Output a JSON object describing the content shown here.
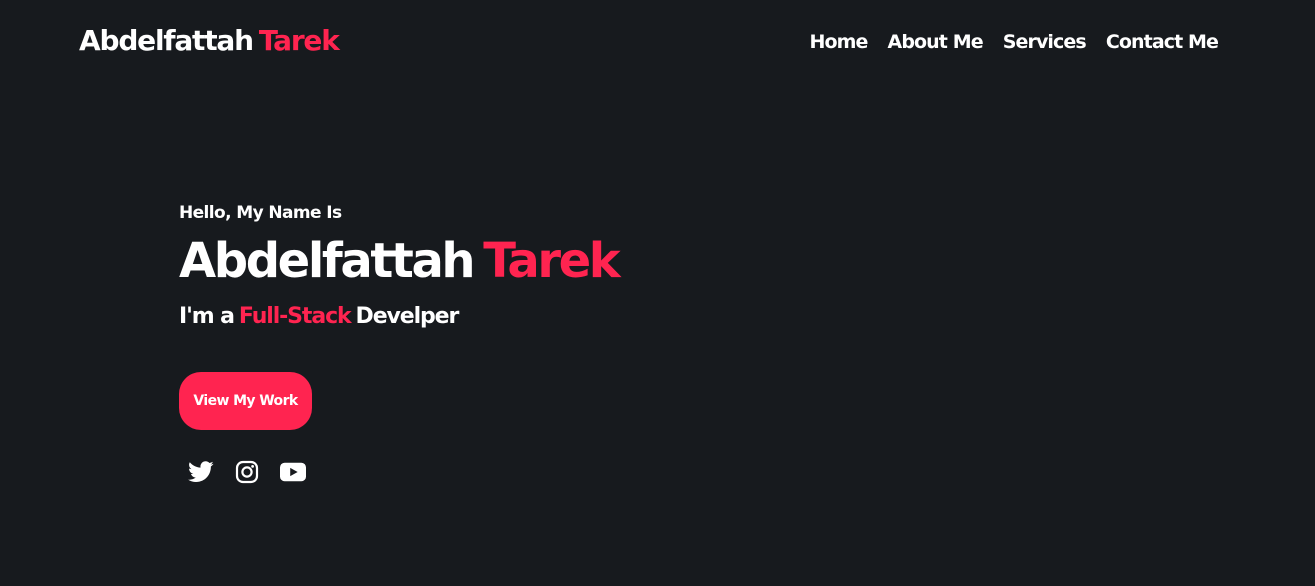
{
  "header": {
    "brand_first": "Abdelfattah",
    "brand_last": "Tarek"
  },
  "nav": {
    "items": [
      {
        "label": "Home"
      },
      {
        "label": "About Me"
      },
      {
        "label": "Services"
      },
      {
        "label": "Contact Me"
      }
    ]
  },
  "hero": {
    "greeting": "Hello, My Name Is",
    "name_first": "Abdelfattah",
    "name_last": "Tarek",
    "role_prefix": "I'm a",
    "role_highlight": "Full-Stack",
    "role_suffix": "Develper",
    "cta_label": "View My Work"
  },
  "socials": [
    {
      "icon": "twitter-icon"
    },
    {
      "icon": "instagram-icon"
    },
    {
      "icon": "youtube-icon"
    }
  ],
  "colors": {
    "background": "#171a1e",
    "accent": "#ff2450",
    "text": "#ffffff"
  }
}
